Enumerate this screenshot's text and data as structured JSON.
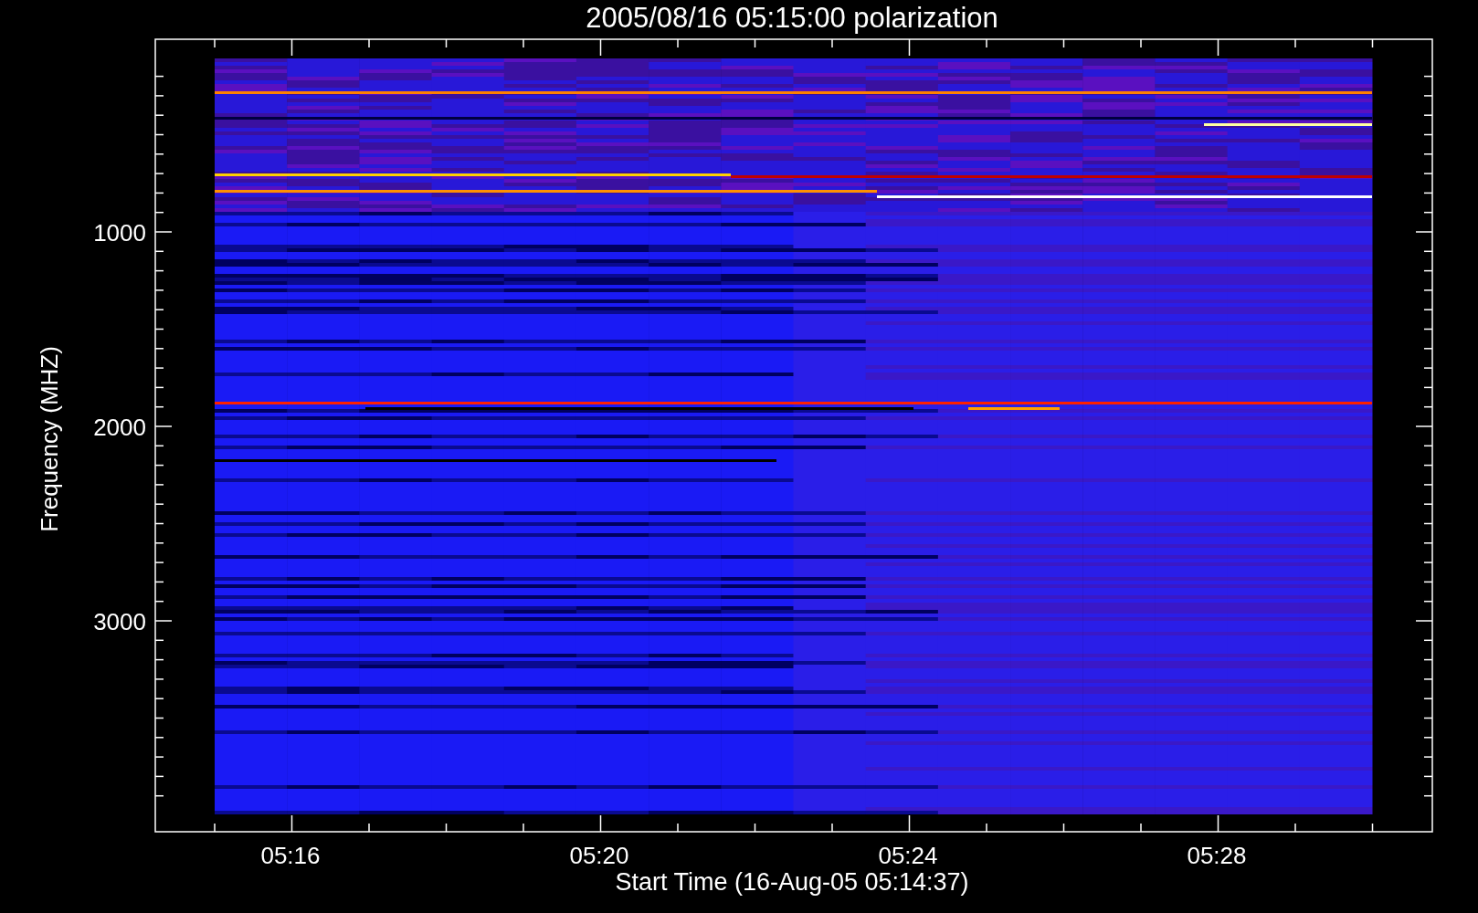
{
  "plot": {
    "title": "2005/08/16 05:15:00 polarization",
    "xlabel": "Start Time (16-Aug-05 05:14:37)",
    "ylabel": "Frequency (MHZ)",
    "yticks": [
      {
        "label": "1000"
      },
      {
        "label": "2000"
      },
      {
        "label": "3000"
      }
    ],
    "xticks": [
      {
        "label": "05:16"
      },
      {
        "label": "05:20"
      },
      {
        "label": "05:24"
      },
      {
        "label": "05:28"
      }
    ]
  }
}
